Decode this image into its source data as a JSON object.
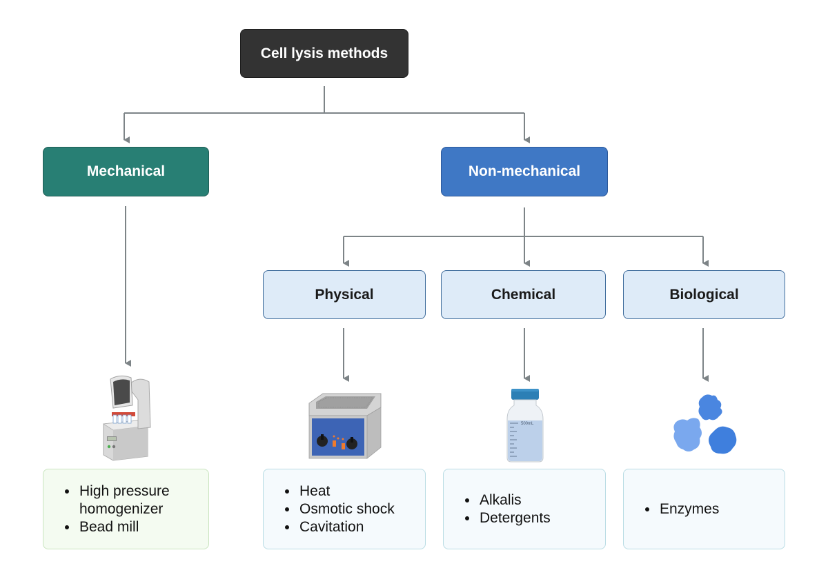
{
  "diagram": {
    "title": "Cell lysis methods",
    "level1": [
      {
        "label": "Mechanical",
        "color": "#287f74"
      },
      {
        "label": "Non-mechanical",
        "color": "#3f78c5"
      }
    ],
    "level2": [
      {
        "label": "Physical"
      },
      {
        "label": "Chemical"
      },
      {
        "label": "Biological"
      }
    ],
    "illustrations": [
      {
        "name": "homogenizer-illustration",
        "depicts": "bead mill / homogenizer instrument"
      },
      {
        "name": "ultrasonic-bath-illustration",
        "depicts": "ultrasonic water bath"
      },
      {
        "name": "reagent-bottle-illustration",
        "depicts": "reagent bottle",
        "bottle_label": "500mL"
      },
      {
        "name": "enzymes-illustration",
        "depicts": "enzyme proteins"
      }
    ],
    "lists": {
      "mechanical": [
        "High pressure homogenizer",
        "Bead mill"
      ],
      "physical": [
        "Heat",
        "Osmotic shock",
        "Cavitation"
      ],
      "chemical": [
        "Alkalis",
        "Detergents"
      ],
      "biological": [
        "Enzymes"
      ]
    },
    "colors": {
      "root": "#333333",
      "connector": "#7d8487",
      "sub_fill": "#deebf8",
      "sub_border": "#3c6a9a"
    }
  }
}
